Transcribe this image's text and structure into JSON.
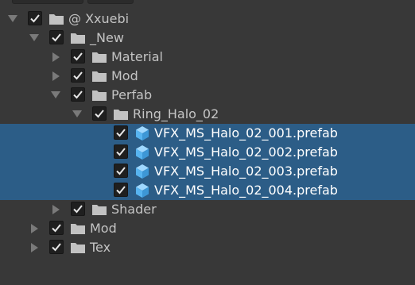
{
  "tree": {
    "rows": [
      {
        "label": "@ Xxuebi",
        "arrow": "down",
        "checked": true,
        "icon": "folder-icon",
        "selected": false
      },
      {
        "label": "_New",
        "arrow": "down",
        "checked": true,
        "icon": "folder-icon",
        "selected": false
      },
      {
        "label": "Material",
        "arrow": "right",
        "checked": true,
        "icon": "folder-icon",
        "selected": false
      },
      {
        "label": "Mod",
        "arrow": "right",
        "checked": true,
        "icon": "folder-icon",
        "selected": false
      },
      {
        "label": "Perfab",
        "arrow": "down",
        "checked": true,
        "icon": "folder-icon",
        "selected": false
      },
      {
        "label": "Ring_Halo_02",
        "arrow": "down",
        "checked": true,
        "icon": "folder-icon",
        "selected": false
      },
      {
        "label": "VFX_MS_Halo_02_001.prefab",
        "arrow": "none",
        "checked": true,
        "icon": "prefab-cube-icon",
        "selected": true
      },
      {
        "label": "VFX_MS_Halo_02_002.prefab",
        "arrow": "none",
        "checked": true,
        "icon": "prefab-cube-icon",
        "selected": true
      },
      {
        "label": "VFX_MS_Halo_02_003.prefab",
        "arrow": "none",
        "checked": true,
        "icon": "prefab-cube-icon",
        "selected": true
      },
      {
        "label": "VFX_MS_Halo_02_004.prefab",
        "arrow": "none",
        "checked": true,
        "icon": "prefab-cube-icon",
        "selected": true
      },
      {
        "label": "Shader",
        "arrow": "right",
        "checked": true,
        "icon": "folder-icon",
        "selected": false
      },
      {
        "label": "Mod",
        "arrow": "right",
        "checked": true,
        "icon": "folder-icon",
        "selected": false
      },
      {
        "label": "Tex",
        "arrow": "right",
        "checked": true,
        "icon": "folder-icon",
        "selected": false
      }
    ]
  },
  "colors": {
    "background": "#383838",
    "selection": "#2c5d87",
    "text": "#c4c4c4",
    "selected_text": "#ffffff",
    "folder": "#c2c2c2",
    "prefab": "#57b4f0"
  }
}
